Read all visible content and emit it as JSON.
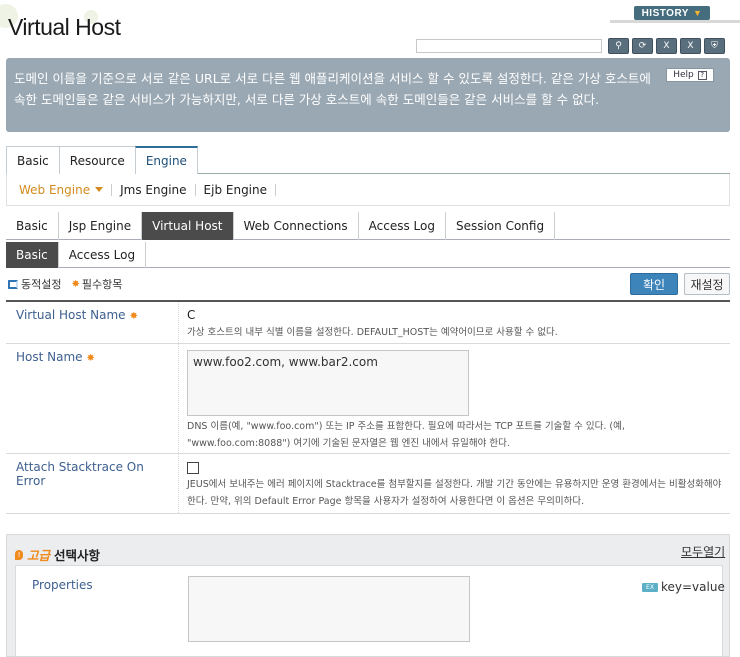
{
  "page": {
    "title": "Virtual Host"
  },
  "header": {
    "history_label": "HISTORY",
    "icons": [
      "search-icon",
      "refresh-icon",
      "xml-export-icon",
      "xml-import-icon",
      "lock-icon"
    ],
    "icon_glyphs": [
      "⚲",
      "⟳",
      "X",
      "X",
      "⛨"
    ]
  },
  "description": {
    "text": "도메인 이름을 기준으로 서로 같은 URL로 서로 다른 웹 애플리케이션을 서비스 할 수 있도록 설정한다. 같은 가상 호스트에 속한 도메인들은 같은 서비스가 가능하지만, 서로 다른 가상 호스트에 속한 도메인들은 같은 서비스를 할 수 없다.",
    "help_label": "Help"
  },
  "tabs_main": [
    {
      "label": "Basic"
    },
    {
      "label": "Resource"
    },
    {
      "label": "Engine"
    }
  ],
  "subnav": [
    {
      "label": "Web Engine"
    },
    {
      "label": "Jms Engine"
    },
    {
      "label": "Ejb Engine"
    }
  ],
  "tabs_engine": [
    {
      "label": "Basic"
    },
    {
      "label": "Jsp Engine"
    },
    {
      "label": "Virtual Host"
    },
    {
      "label": "Web Connections"
    },
    {
      "label": "Access Log"
    },
    {
      "label": "Session Config"
    }
  ],
  "tabs_vhost": [
    {
      "label": "Basic"
    },
    {
      "label": "Access Log"
    }
  ],
  "legend": {
    "dynamic": "동적설정",
    "required": "필수항목"
  },
  "actions": {
    "ok": "확인",
    "reset": "재설정"
  },
  "form": {
    "vhost_name": {
      "label": "Virtual Host Name",
      "value": "C",
      "desc": "가상 호스트의 내부 식별 이름을 설정한다. DEFAULT_HOST는 예약어이므로 사용할 수 없다."
    },
    "host_name": {
      "label": "Host Name",
      "value": "www.foo2.com, www.bar2.com",
      "desc": "DNS 이름(예, \"www.foo.com\") 또는 IP 주소를 표함한다. 필요에 따라서는 TCP 포트를 기술할 수 있다. (예, \"www.foo.com:8088\") 여기에 기술된 문자열은 웹 엔진 내에서 유일해야 한다."
    },
    "stacktrace": {
      "label": "Attach Stacktrace On Error",
      "checked": false,
      "desc": "JEUS에서 보내주는 에러 페이지에 Stacktrace를 첨부할지를 설정한다. 개발 기간 동안에는 유용하지만 운영 환경에서는 비활성화해야 한다. 만약, 위의 Default Error Page 항목을 사용자가 설정하여 사용한다면 이 옵션은 무의미하다."
    }
  },
  "advanced": {
    "title_em": "고급",
    "title_rest": "선택사항",
    "expand_label": "모두열기",
    "properties_label": "Properties",
    "kv_label": "key=value"
  }
}
